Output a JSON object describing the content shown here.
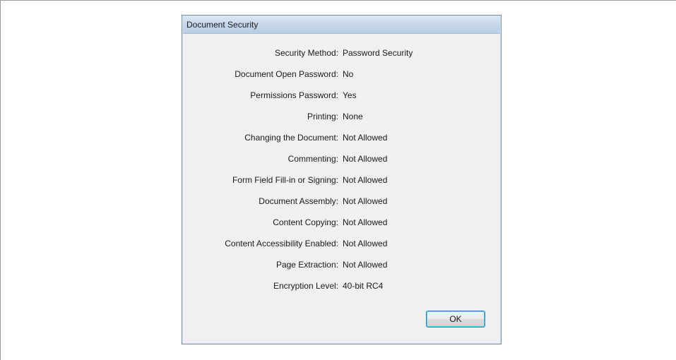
{
  "dialog": {
    "title": "Document Security",
    "rows": [
      {
        "label": "Security Method:",
        "value": "Password Security"
      },
      {
        "label": "Document Open Password:",
        "value": "No"
      },
      {
        "label": "Permissions Password:",
        "value": "Yes"
      },
      {
        "label": "Printing:",
        "value": "None"
      },
      {
        "label": "Changing the Document:",
        "value": "Not Allowed"
      },
      {
        "label": "Commenting:",
        "value": "Not Allowed"
      },
      {
        "label": "Form Field Fill-in or Signing:",
        "value": "Not Allowed"
      },
      {
        "label": "Document Assembly:",
        "value": "Not Allowed"
      },
      {
        "label": "Content Copying:",
        "value": "Not Allowed"
      },
      {
        "label": "Content Accessibility Enabled:",
        "value": "Not Allowed"
      },
      {
        "label": "Page Extraction:",
        "value": "Not Allowed"
      },
      {
        "label": "Encryption Level:",
        "value": "40-bit RC4"
      }
    ],
    "ok_label": "OK"
  }
}
